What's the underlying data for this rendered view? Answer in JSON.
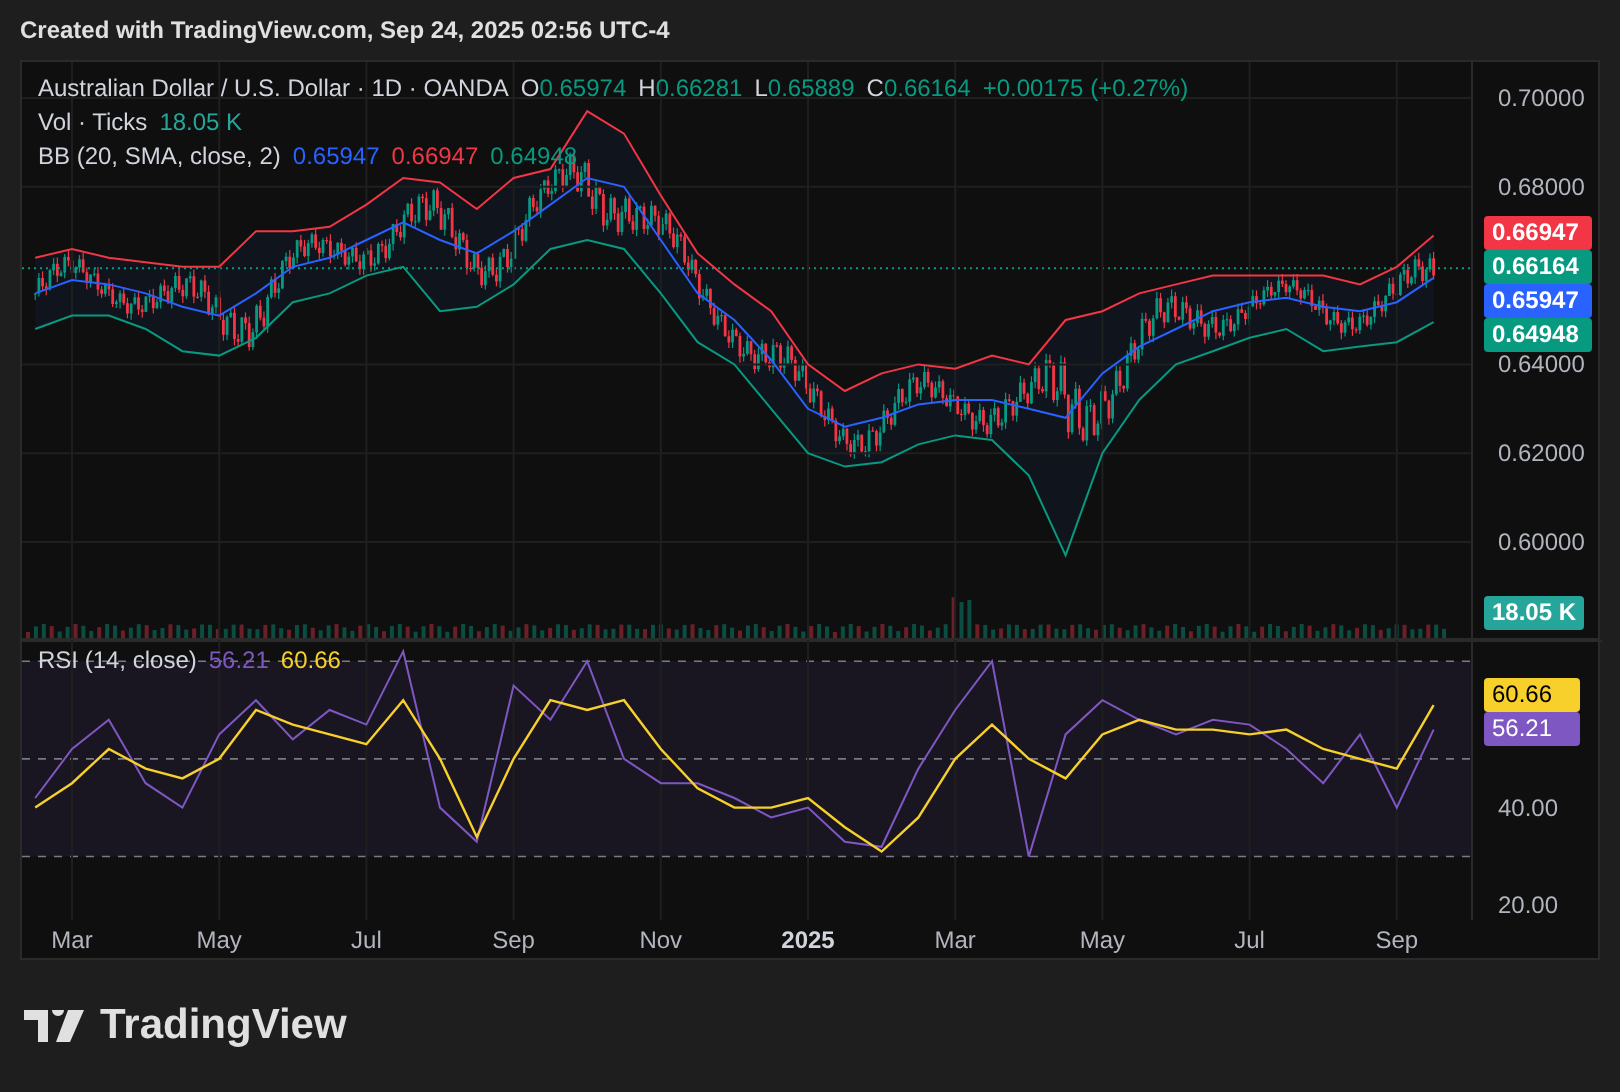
{
  "header": {
    "text": "Created with TradingView.com, Sep 24, 2025 02:56 UTC-4"
  },
  "legend": {
    "symbol": "Australian Dollar / U.S. Dollar · 1D · OANDA",
    "ohlc": [
      {
        "key": "O",
        "value": "0.65974"
      },
      {
        "key": "H",
        "value": "0.66281"
      },
      {
        "key": "L",
        "value": "0.65889"
      },
      {
        "key": "C",
        "value": "0.66164"
      }
    ],
    "change": "+0.00175 (+0.27%)"
  },
  "volume_legend": {
    "label": "Vol · Ticks",
    "value": "18.05 K"
  },
  "bb_legend": {
    "label": "BB (20, SMA, close, 2)",
    "values": [
      {
        "text": "0.65947",
        "color": "#2962ff"
      },
      {
        "text": "0.66947",
        "color": "#f23645"
      },
      {
        "text": "0.64948",
        "color": "#089981"
      }
    ]
  },
  "price_chart": {
    "chart_data": {
      "type": "line",
      "grid": true,
      "ylim": [
        0.5784,
        0.7081
      ],
      "yticks": [
        {
          "value": 0.7,
          "label": "0.70000"
        },
        {
          "value": 0.68,
          "label": "0.68000"
        },
        {
          "value": 0.64,
          "label": "0.64000"
        },
        {
          "value": 0.62,
          "label": "0.62000"
        },
        {
          "value": 0.6,
          "label": "0.60000"
        }
      ],
      "series": [
        {
          "color": "#f23645",
          "values": [
            0.664,
            0.666,
            0.664,
            0.663,
            0.662,
            0.662,
            0.67,
            0.67,
            0.671,
            0.676,
            0.682,
            0.681,
            0.675,
            0.682,
            0.684,
            0.697,
            0.692,
            0.678,
            0.665,
            0.658,
            0.652,
            0.64,
            0.634,
            0.638,
            0.64,
            0.639,
            0.642,
            0.64,
            0.65,
            0.652,
            0.656,
            0.658,
            0.66,
            0.66,
            0.66,
            0.66,
            0.658,
            0.662,
            0.669
          ]
        },
        {
          "color": "#2962ff",
          "values": [
            0.656,
            0.659,
            0.658,
            0.656,
            0.653,
            0.651,
            0.656,
            0.662,
            0.664,
            0.668,
            0.672,
            0.668,
            0.665,
            0.67,
            0.676,
            0.682,
            0.68,
            0.668,
            0.656,
            0.65,
            0.641,
            0.63,
            0.626,
            0.628,
            0.631,
            0.632,
            0.632,
            0.63,
            0.628,
            0.638,
            0.644,
            0.648,
            0.652,
            0.654,
            0.655,
            0.653,
            0.652,
            0.654,
            0.6595
          ]
        },
        {
          "color": "#089981",
          "values": [
            0.648,
            0.651,
            0.651,
            0.648,
            0.643,
            0.642,
            0.646,
            0.654,
            0.656,
            0.66,
            0.662,
            0.652,
            0.653,
            0.658,
            0.666,
            0.668,
            0.666,
            0.656,
            0.645,
            0.64,
            0.63,
            0.62,
            0.617,
            0.618,
            0.622,
            0.624,
            0.623,
            0.615,
            0.597,
            0.62,
            0.632,
            0.64,
            0.643,
            0.646,
            0.648,
            0.643,
            0.644,
            0.645,
            0.6495
          ]
        }
      ]
    }
  },
  "price_labels": [
    {
      "text": "0.66947",
      "color": "#f23645"
    },
    {
      "text": "0.66164",
      "color": "#089981"
    },
    {
      "text": "0.65947",
      "color": "#2962ff"
    },
    {
      "text": "0.64948",
      "color": "#089981"
    }
  ],
  "volume_label": {
    "text": "18.05 K"
  },
  "rsi_legend": {
    "label": "RSI (14, close)",
    "values": [
      {
        "text": "56.21",
        "color": "#7e57c2"
      },
      {
        "text": "60.66",
        "color": "#f7d02c"
      }
    ]
  },
  "rsi_chart": {
    "chart_data": {
      "type": "line",
      "grid": true,
      "ylim": [
        17,
        74.34
      ],
      "yticks": [
        {
          "value": 40,
          "label": "40.00"
        },
        {
          "value": 20,
          "label": "20.00"
        }
      ],
      "categories": [
        null,
        "Mar",
        null,
        null,
        null,
        "May",
        null,
        null,
        null,
        "Jul",
        null,
        null,
        null,
        "Sep",
        null,
        null,
        null,
        "Nov",
        null,
        null,
        null,
        "2025",
        null,
        null,
        null,
        "Mar",
        null,
        null,
        null,
        "May",
        null,
        null,
        null,
        "Jul",
        null,
        null,
        null,
        "Sep",
        null
      ],
      "series": [
        {
          "color": "#7e57c2",
          "values": [
            42,
            52,
            58,
            45,
            40,
            55,
            62,
            54,
            60,
            57,
            72,
            40,
            33,
            65,
            58,
            70,
            50,
            45,
            45,
            42,
            38,
            40,
            33,
            32,
            48,
            60,
            70,
            30,
            55,
            62,
            58,
            55,
            58,
            57,
            52,
            45,
            55,
            40,
            56
          ]
        },
        {
          "color": "#f7d02c",
          "values": [
            40,
            45,
            52,
            48,
            46,
            50,
            60,
            57,
            55,
            53,
            62,
            50,
            34,
            50,
            62,
            60,
            62,
            52,
            44,
            40,
            40,
            42,
            36,
            31,
            38,
            50,
            57,
            50,
            46,
            55,
            58,
            56,
            56,
            55,
            56,
            52,
            50,
            48,
            61
          ]
        }
      ]
    }
  },
  "rsi_labels": [
    {
      "text": "60.66",
      "color": "#f7d02c"
    },
    {
      "text": "56.21",
      "color": "#7e57c2"
    }
  ],
  "footer": {
    "logo_text": "TradingView"
  }
}
